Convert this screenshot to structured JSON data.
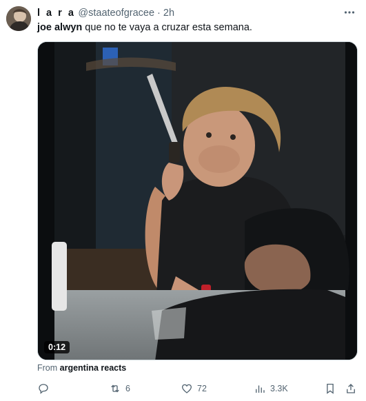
{
  "author": {
    "name": "l a r a",
    "handle": "@staateofgracee",
    "separator": "·",
    "time": "2h"
  },
  "tweet": {
    "text_bold": "joe alwyn",
    "text_rest": " que no te vaya a cruzar esta semana."
  },
  "media": {
    "duration": "0:12"
  },
  "source": {
    "prefix": "From ",
    "name": "argentina reacts"
  },
  "actions": {
    "reply_count": "",
    "retweet_count": "6",
    "like_count": "72",
    "views_count": "3.3K"
  },
  "colors": {
    "text_primary": "#0f1419",
    "text_secondary": "#536471",
    "border": "#cfd9de"
  },
  "icons": {
    "more": "more-dots-icon",
    "reply": "reply-icon",
    "retweet": "retweet-icon",
    "like": "heart-icon",
    "views": "views-icon",
    "bookmark": "bookmark-icon",
    "share": "share-icon"
  }
}
